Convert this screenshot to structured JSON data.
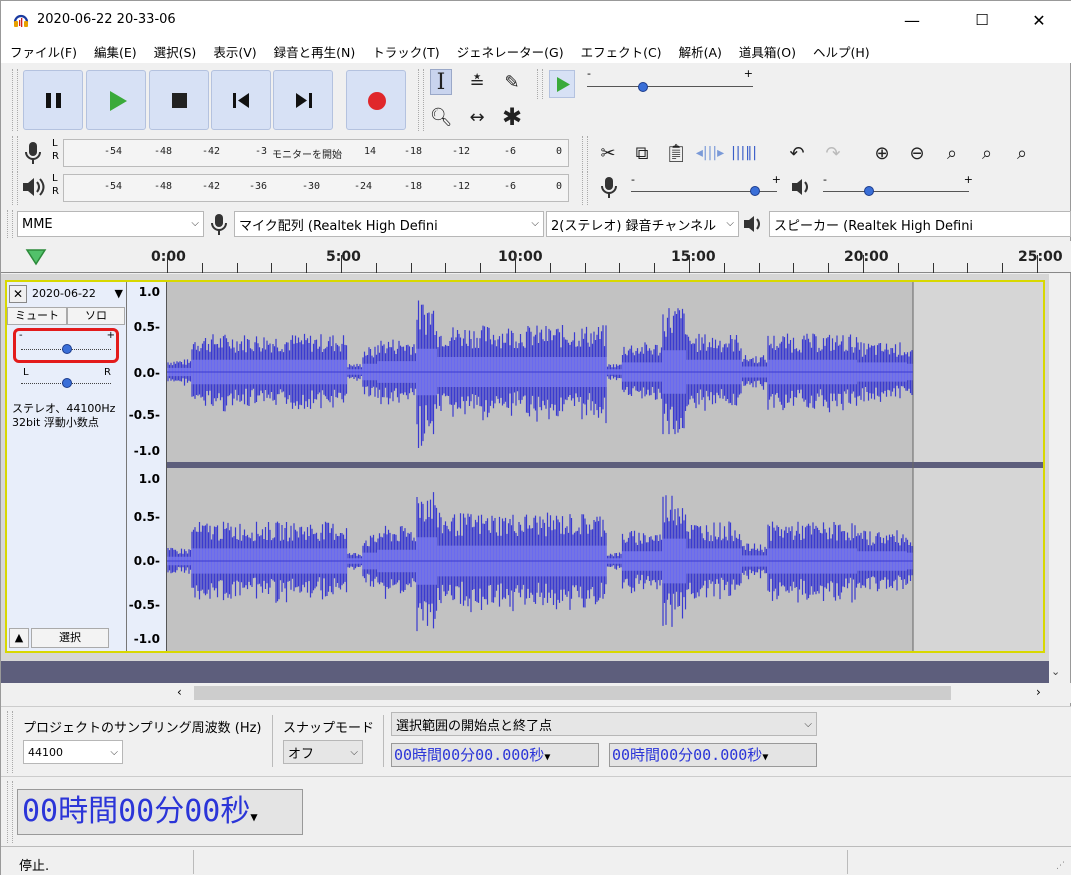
{
  "window": {
    "title": "2020-06-22 20-33-06",
    "minimize": "—",
    "maximize": "☐",
    "close": "✕"
  },
  "menu": [
    "ファイル(F)",
    "編集(E)",
    "選択(S)",
    "表示(V)",
    "録音と再生(N)",
    "トラック(T)",
    "ジェネレーター(G)",
    "エフェクト(C)",
    "解析(A)",
    "道具箱(O)",
    "ヘルプ(H)"
  ],
  "meters": {
    "record_ticks": [
      "-54",
      "-48",
      "-42",
      "-3",
      "モニターを開始",
      "14",
      "-18",
      "-12",
      "-6",
      "0"
    ],
    "play_ticks": [
      "-54",
      "-48",
      "-42",
      "-36",
      "-30",
      "-24",
      "-18",
      "-12",
      "-6",
      "0"
    ],
    "channels": [
      "L",
      "R"
    ]
  },
  "slider_marks": {
    "minus": "-",
    "plus": "+"
  },
  "devices": {
    "host": "MME",
    "mic": "マイク配列 (Realtek High Defini",
    "channels": "2(ステレオ) 録音チャンネル",
    "speaker": "スピーカー (Realtek High Defini"
  },
  "ruler": [
    "0:00",
    "5:00",
    "10:00",
    "15:00",
    "20:00",
    "25:00"
  ],
  "track": {
    "name": "2020-06-22",
    "mute": "ミュート",
    "solo": "ソロ",
    "gain_min": "-",
    "gain_max": "+",
    "pan_left": "L",
    "pan_right": "R",
    "info_line1": "ステレオ、44100Hz",
    "info_line2": "32bit 浮動小数点",
    "select": "選択",
    "vruler": [
      "1.0",
      "0.5-",
      "0.0-",
      "-0.5-",
      "-1.0"
    ]
  },
  "bottom": {
    "rate_label": "プロジェクトのサンプリング周波数 (Hz)",
    "rate_value": "44100",
    "snap_label": "スナップモード",
    "snap_value": "オフ",
    "sel_mode": "選択範囲の開始点と終了点",
    "sel_start": "00時間00分00.000秒",
    "sel_end": "00時間00分00.000秒",
    "big_time": "00時間00分00秒"
  },
  "status": "停止.",
  "colors": {
    "wave": "#3a3ad0",
    "record": "#e0272b",
    "play": "#3aaa3a",
    "track_border": "#d8d800",
    "highlight": "#e31b1b"
  }
}
